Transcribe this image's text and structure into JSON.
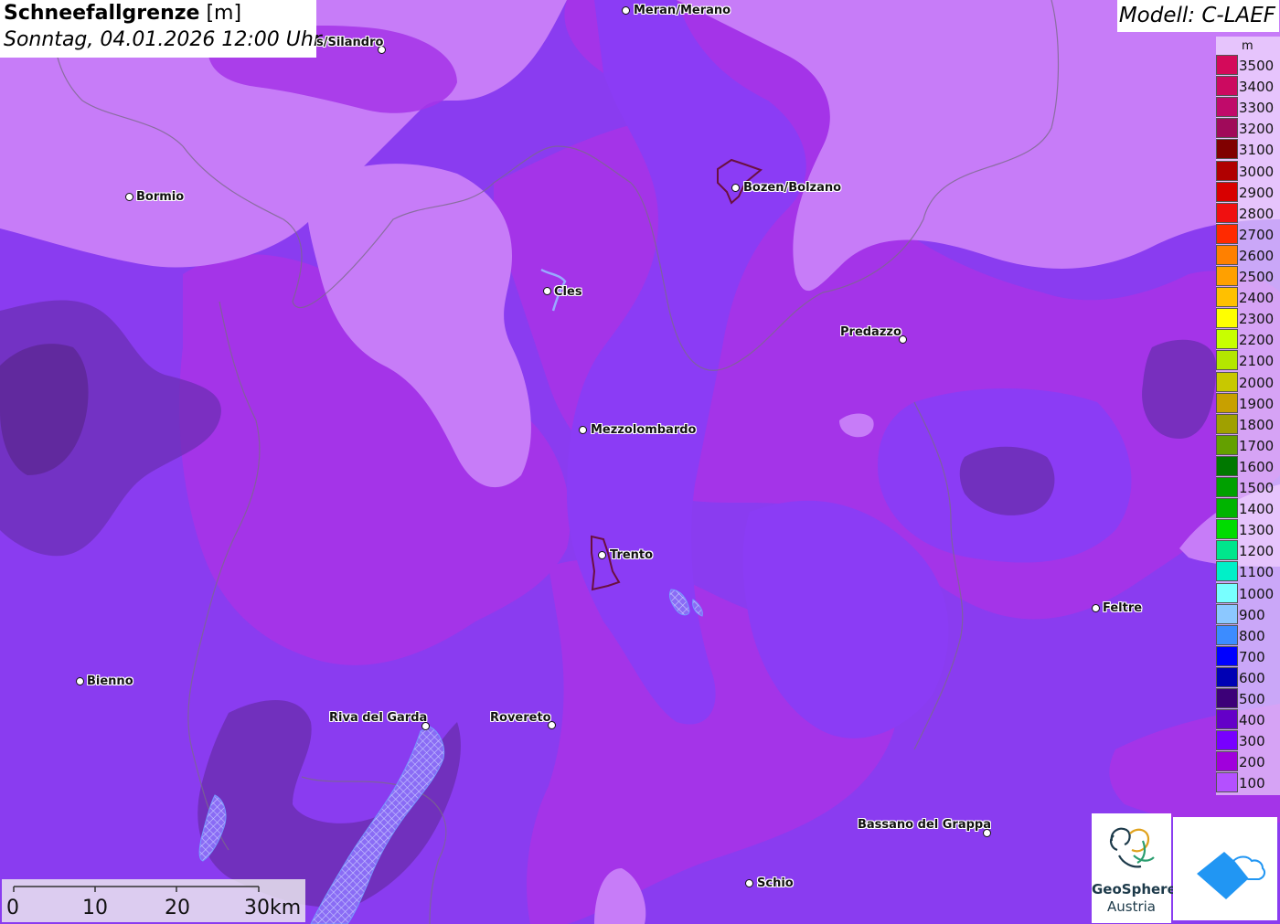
{
  "header": {
    "title": "Schneefallgrenze",
    "unit": "[m]",
    "datetime": "Sonntag, 04.01.2026 12:00 Uhr"
  },
  "model": "Modell: C-LAEF",
  "legend": {
    "unit": "m",
    "items": [
      {
        "label": "3500",
        "color": "#d40a5a"
      },
      {
        "label": "3400",
        "color": "#cc0a60"
      },
      {
        "label": "3300",
        "color": "#c00a6a"
      },
      {
        "label": "3200",
        "color": "#a00a5a"
      },
      {
        "label": "3100",
        "color": "#800000"
      },
      {
        "label": "3000",
        "color": "#b00000"
      },
      {
        "label": "2900",
        "color": "#d80000"
      },
      {
        "label": "2800",
        "color": "#f01010"
      },
      {
        "label": "2700",
        "color": "#ff2a00"
      },
      {
        "label": "2600",
        "color": "#ff8000"
      },
      {
        "label": "2500",
        "color": "#ffa000"
      },
      {
        "label": "2400",
        "color": "#ffc000"
      },
      {
        "label": "2300",
        "color": "#ffff00"
      },
      {
        "label": "2200",
        "color": "#c8ff00"
      },
      {
        "label": "2100",
        "color": "#b4e600"
      },
      {
        "label": "2000",
        "color": "#c8c800"
      },
      {
        "label": "1900",
        "color": "#c8a000"
      },
      {
        "label": "1800",
        "color": "#a0a000"
      },
      {
        "label": "1700",
        "color": "#64a000"
      },
      {
        "label": "1600",
        "color": "#007800"
      },
      {
        "label": "1500",
        "color": "#00a000"
      },
      {
        "label": "1400",
        "color": "#00b400"
      },
      {
        "label": "1300",
        "color": "#00dc00"
      },
      {
        "label": "1200",
        "color": "#00e68c"
      },
      {
        "label": "1100",
        "color": "#00f0c8"
      },
      {
        "label": "1000",
        "color": "#78ffff"
      },
      {
        "label": "900",
        "color": "#8cc8ff"
      },
      {
        "label": "800",
        "color": "#3c8cff"
      },
      {
        "label": "700",
        "color": "#0000ff"
      },
      {
        "label": "600",
        "color": "#0000b4"
      },
      {
        "label": "500",
        "color": "#3c0078"
      },
      {
        "label": "400",
        "color": "#6400c8"
      },
      {
        "label": "300",
        "color": "#7800ff"
      },
      {
        "label": "200",
        "color": "#a000dc"
      },
      {
        "label": "100",
        "color": "#b450ff"
      }
    ]
  },
  "cities": [
    {
      "name": "Meran/Merano"
    },
    {
      "name": "s/Silandro"
    },
    {
      "name": "Bormio"
    },
    {
      "name": "Bozen/Bolzano"
    },
    {
      "name": "Cles"
    },
    {
      "name": "Predazzo"
    },
    {
      "name": "Mezzolombardo"
    },
    {
      "name": "Trento"
    },
    {
      "name": "Feltre"
    },
    {
      "name": "Bienno"
    },
    {
      "name": "Riva del Garda"
    },
    {
      "name": "Rovereto"
    },
    {
      "name": "Bassano del Grappa"
    },
    {
      "name": "Schio"
    }
  ],
  "scalebar": {
    "labels": [
      "0",
      "10",
      "20",
      "30km"
    ]
  },
  "logo": {
    "line1": "GeoSphere",
    "line2": "Austria"
  }
}
